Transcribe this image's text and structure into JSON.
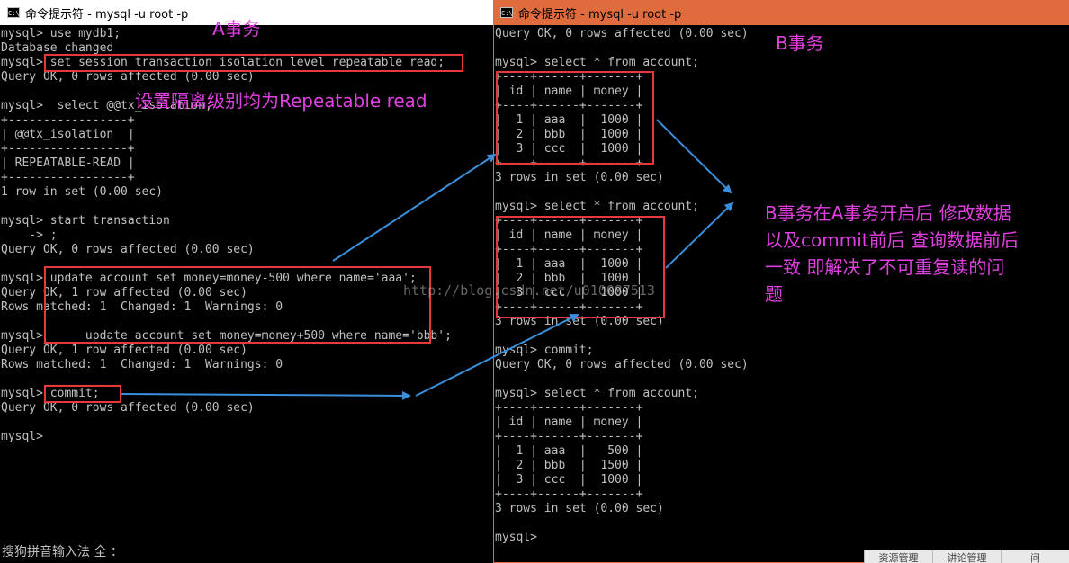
{
  "window_a": {
    "title": "命令提示符 - mysql  -u root -p",
    "icon": "cmd-icon",
    "lines": [
      "mysql> use mydb1;",
      "Database changed",
      "mysql> set session transaction isolation level repeatable read;",
      "Query OK, 0 rows affected (0.00 sec)",
      "",
      "mysql>  select @@tx_isolation;",
      "+-----------------+",
      "| @@tx_isolation  |",
      "+-----------------+",
      "| REPEATABLE-READ |",
      "+-----------------+",
      "1 row in set (0.00 sec)",
      "",
      "mysql> start transaction",
      "    -> ;",
      "Query OK, 0 rows affected (0.00 sec)",
      "",
      "mysql> update account set money=money-500 where name='aaa';",
      "Query OK, 1 row affected (0.00 sec)",
      "Rows matched: 1  Changed: 1  Warnings: 0",
      "",
      "mysql>      update account set money=money+500 where name='bbb';",
      "Query OK, 1 row affected (0.00 sec)",
      "Rows matched: 1  Changed: 1  Warnings: 0",
      "",
      "mysql> commit;",
      "Query OK, 0 rows affected (0.00 sec)",
      "",
      "mysql>"
    ],
    "ime_status": "搜狗拼音输入法 全 ："
  },
  "window_b": {
    "title": "命令提示符 - mysql  -u root -p",
    "icon": "cmd-icon",
    "lines": [
      "Query OK, 0 rows affected (0.00 sec)",
      "",
      "mysql> select * from account;",
      "+----+------+-------+",
      "| id | name | money |",
      "+----+------+-------+",
      "|  1 | aaa  |  1000 |",
      "|  2 | bbb  |  1000 |",
      "|  3 | ccc  |  1000 |",
      "+----+------+-------+",
      "3 rows in set (0.00 sec)",
      "",
      "mysql> select * from account;",
      "+----+------+-------+",
      "| id | name | money |",
      "+----+------+-------+",
      "|  1 | aaa  |  1000 |",
      "|  2 | bbb  |  1000 |",
      "|  3 | ccc  |  1000 |",
      "+----+------+-------+",
      "3 rows in set (0.00 sec)",
      "",
      "mysql> commit;",
      "Query OK, 0 rows affected (0.00 sec)",
      "",
      "mysql> select * from account;",
      "+----+------+-------+",
      "| id | name | money |",
      "+----+------+-------+",
      "|  1 | aaa  |   500 |",
      "|  2 | bbb  |  1500 |",
      "|  3 | ccc  |  1000 |",
      "+----+------+-------+",
      "3 rows in set (0.00 sec)",
      "",
      "mysql>"
    ]
  },
  "annotations": {
    "label_a": "A事务",
    "label_b": "B事务",
    "label_isolation": "设置隔离级别均为Repeatable read",
    "note_lines": [
      "B事务在A事务开启后 修改数据",
      "以及commit前后 查询数据前后",
      "一致 即解决了不可重复读的问",
      "题"
    ]
  },
  "watermark": "http://blog.csdn.net/u010087513",
  "taskbar": [
    "资源管理",
    "讲论管理",
    "问"
  ],
  "colors": {
    "console_bg": "#000000",
    "console_text": "#c0c0c0",
    "title_active": "#e06b3c",
    "title_inactive": "#ffffff",
    "highlight_box": "#e8383a",
    "annotation_text": "#e040e0",
    "arrow": "#3a8fdc"
  }
}
